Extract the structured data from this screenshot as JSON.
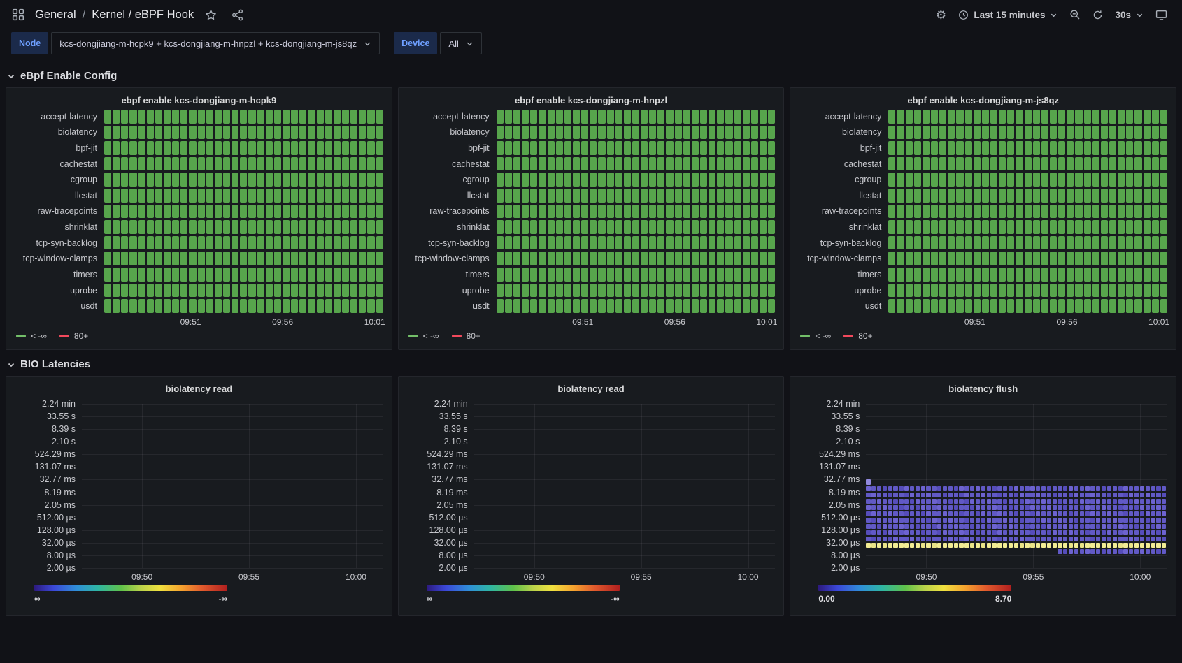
{
  "colors": {
    "page_background": "#111217",
    "panel_background": "#181b1f",
    "enabled_green": "#73bf69",
    "threshold_red": "#f2495c",
    "heatmap_purple": "#6159c5",
    "heatmap_yellow": "#f2ec93",
    "variable_label_blue": "#6e9fff"
  },
  "icons": {
    "gear_glyph": "⚙",
    "names": [
      "apps-grid-icon",
      "star-icon",
      "share-icon",
      "gear-icon",
      "clock-icon",
      "chevron-down-icon",
      "zoom-out-icon",
      "refresh-icon",
      "monitor-icon"
    ]
  },
  "topnav": {
    "breadcrumb": [
      "General",
      "Kernel / eBPF Hook"
    ],
    "breadcrumb_separator": "/",
    "time_range": "Last 15 minutes",
    "refresh_interval": "30s"
  },
  "variables": {
    "node_label": "Node",
    "node_value": "kcs-dongjiang-m-hcpk9 + kcs-dongjiang-m-hnpzl + kcs-dongjiang-m-js8qz",
    "device_label": "Device",
    "device_value": "All"
  },
  "rows": {
    "ebpf": "eBpf Enable Config",
    "bio": "BIO Latencies"
  },
  "chart_data": [
    {
      "type": "heatmap",
      "subtype": "status-grid",
      "title": "ebpf enable kcs-dongjiang-m-hcpk9",
      "categories": [
        "accept-latency",
        "biolatency",
        "bpf-jit",
        "cachestat",
        "cgroup",
        "llcstat",
        "raw-tracepoints",
        "shrinklat",
        "tcp-syn-backlog",
        "tcp-window-clamps",
        "timers",
        "uprobe",
        "usdt"
      ],
      "x_ticks": [
        "09:51",
        "09:56",
        "10:01"
      ],
      "columns": 33,
      "values": "every metric shows the green '< -∞' (enabled) state for all time buckets across the full range",
      "legend": [
        {
          "label": "< -∞",
          "color": "#73bf69"
        },
        {
          "label": "80+",
          "color": "#f2495c"
        }
      ]
    },
    {
      "type": "heatmap",
      "subtype": "status-grid",
      "title": "ebpf enable kcs-dongjiang-m-hnpzl",
      "categories": [
        "accept-latency",
        "biolatency",
        "bpf-jit",
        "cachestat",
        "cgroup",
        "llcstat",
        "raw-tracepoints",
        "shrinklat",
        "tcp-syn-backlog",
        "tcp-window-clamps",
        "timers",
        "uprobe",
        "usdt"
      ],
      "x_ticks": [
        "09:51",
        "09:56",
        "10:01"
      ],
      "columns": 33,
      "values": "every metric shows the green '< -∞' (enabled) state for all time buckets across the full range",
      "legend": [
        {
          "label": "< -∞",
          "color": "#73bf69"
        },
        {
          "label": "80+",
          "color": "#f2495c"
        }
      ]
    },
    {
      "type": "heatmap",
      "subtype": "status-grid",
      "title": "ebpf enable kcs-dongjiang-m-js8qz",
      "categories": [
        "accept-latency",
        "biolatency",
        "bpf-jit",
        "cachestat",
        "cgroup",
        "llcstat",
        "raw-tracepoints",
        "shrinklat",
        "tcp-syn-backlog",
        "tcp-window-clamps",
        "timers",
        "uprobe",
        "usdt"
      ],
      "x_ticks": [
        "09:51",
        "09:56",
        "10:01"
      ],
      "columns": 33,
      "values": "every metric shows the green '< -∞' (enabled) state for all time buckets across the full range",
      "legend": [
        {
          "label": "< -∞",
          "color": "#73bf69"
        },
        {
          "label": "80+",
          "color": "#f2495c"
        }
      ]
    },
    {
      "type": "heatmap",
      "title": "biolatency read",
      "y_ticks": [
        "2.24 min",
        "33.55 s",
        "8.39 s",
        "2.10 s",
        "524.29 ms",
        "131.07 ms",
        "32.77 ms",
        "8.19 ms",
        "2.05 ms",
        "512.00 µs",
        "128.00 µs",
        "32.00 µs",
        "8.00 µs",
        "2.00 µs"
      ],
      "x_ticks": [
        "09:50",
        "09:55",
        "10:00"
      ],
      "values": "no data (empty heatmap, gridlines only)",
      "legend": {
        "min": "∞",
        "max": "-∞"
      }
    },
    {
      "type": "heatmap",
      "title": "biolatency read",
      "y_ticks": [
        "2.24 min",
        "33.55 s",
        "8.39 s",
        "2.10 s",
        "524.29 ms",
        "131.07 ms",
        "32.77 ms",
        "8.19 ms",
        "2.05 ms",
        "512.00 µs",
        "128.00 µs",
        "32.00 µs",
        "8.00 µs",
        "2.00 µs"
      ],
      "x_ticks": [
        "09:50",
        "09:55",
        "10:00"
      ],
      "values": "no data (empty heatmap, gridlines only)",
      "legend": {
        "min": "∞",
        "max": "-∞"
      }
    },
    {
      "type": "heatmap",
      "title": "biolatency flush",
      "y_ticks": [
        "2.24 min",
        "33.55 s",
        "8.39 s",
        "2.10 s",
        "524.29 ms",
        "131.07 ms",
        "32.77 ms",
        "8.19 ms",
        "2.05 ms",
        "512.00 µs",
        "128.00 µs",
        "32.00 µs",
        "8.00 µs",
        "2.00 µs"
      ],
      "x_ticks": [
        "09:50",
        "09:55",
        "10:00"
      ],
      "columns": 55,
      "legend": {
        "min": "0.00",
        "max": "8.70"
      },
      "bands": [
        {
          "bucket": "16.38–32.77 ms",
          "top_step": 12,
          "col_start": 0,
          "col_end": 0,
          "color": "light"
        },
        {
          "bucket": "8.19–16.38 ms",
          "top_step": 13,
          "col_start": 0,
          "col_end": 54,
          "color": "purple"
        },
        {
          "bucket": "4.10–8.19 ms",
          "top_step": 14,
          "col_start": 0,
          "col_end": 54,
          "color": "purple"
        },
        {
          "bucket": "2.05–4.10 ms",
          "top_step": 15,
          "col_start": 0,
          "col_end": 54,
          "color": "purple"
        },
        {
          "bucket": "1.02–2.05 ms",
          "top_step": 16,
          "col_start": 0,
          "col_end": 54,
          "color": "purple"
        },
        {
          "bucket": "512 µs–1.02 ms",
          "top_step": 17,
          "col_start": 0,
          "col_end": 54,
          "color": "purple"
        },
        {
          "bucket": "256–512 µs",
          "top_step": 18,
          "col_start": 0,
          "col_end": 54,
          "color": "purple"
        },
        {
          "bucket": "128–256 µs",
          "top_step": 19,
          "col_start": 0,
          "col_end": 54,
          "color": "purple"
        },
        {
          "bucket": "64–128 µs",
          "top_step": 20,
          "col_start": 0,
          "col_end": 54,
          "color": "purple"
        },
        {
          "bucket": "32–64 µs",
          "top_step": 21,
          "col_start": 0,
          "col_end": 54,
          "color": "purple"
        },
        {
          "bucket": "16–32 µs (hot band)",
          "top_step": 22,
          "col_start": 0,
          "col_end": 54,
          "color": "yellow"
        },
        {
          "bucket": "8–16 µs",
          "top_step": 23,
          "col_start": 35,
          "col_end": 54,
          "color": "purple"
        }
      ]
    }
  ]
}
